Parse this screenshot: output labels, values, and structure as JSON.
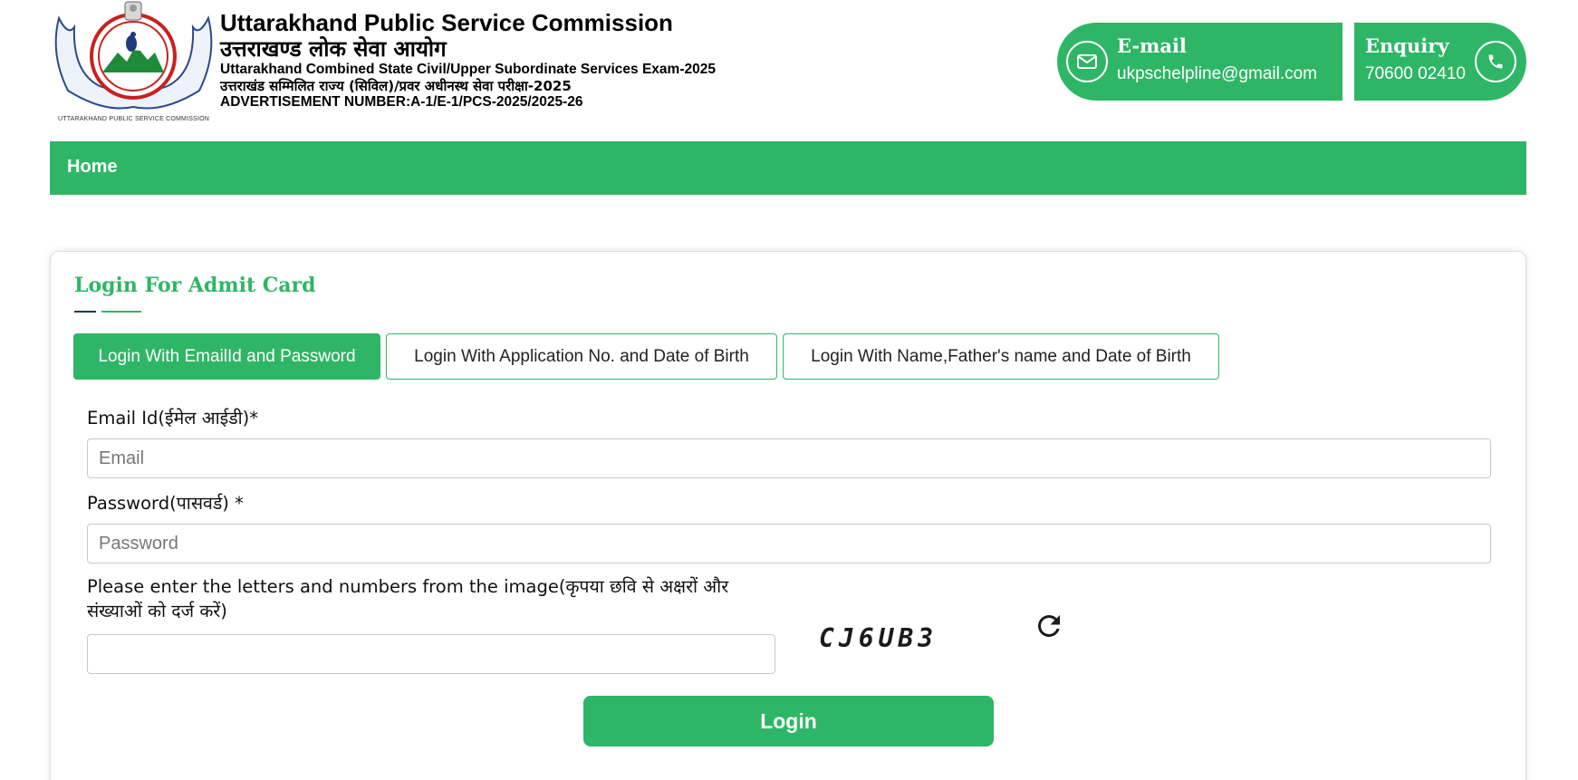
{
  "header": {
    "logo_caption": "UTTARAKHAND PUBLIC SERVICE COMMISSION",
    "logo_hindi": "उत्तराखण्ड लोकसेवा आयोग",
    "title_en": "Uttarakhand Public Service Commission",
    "title_hi": "उत्तराखण्ड लोक सेवा आयोग",
    "exam_en": "Uttarakhand Combined State Civil/Upper Subordinate Services Exam-2025",
    "exam_hi": "उत्तराखंड सम्मिलित राज्य (सिविल)/प्रवर अधीनस्थ सेवा परीक्षा-2025",
    "advertisement": "ADVERTISEMENT NUMBER:A-1/E-1/PCS-2025/2025-26"
  },
  "contact": {
    "email_label": "E-mail",
    "email_value": "ukpschelpline@gmail.com",
    "enquiry_label": "Enquiry",
    "enquiry_value": "70600 02410"
  },
  "nav": {
    "home": "Home"
  },
  "login": {
    "title": "Login For Admit Card",
    "tabs": [
      {
        "label": "Login With EmailId and Password",
        "active": true
      },
      {
        "label": "Login With Application No. and Date of Birth",
        "active": false
      },
      {
        "label": "Login With Name,Father's name and Date of Birth",
        "active": false
      }
    ],
    "email_label": "Email Id(ईमेल आईडी)*",
    "email_placeholder": "Email",
    "password_label": "Password(पासवर्ड) *",
    "password_placeholder": "Password",
    "captcha_label": "Please enter the letters and numbers from the image(कृपया छवि से अक्षरों और संख्याओं को दर्ज करें)",
    "captcha_value": "",
    "captcha_text": "CJ6UB3",
    "login_button": "Login"
  },
  "colors": {
    "brand_green": "#2eb666",
    "underline_navy": "#1f3a5c"
  },
  "icons": {
    "email": "envelope-icon",
    "enquiry": "phone-icon",
    "refresh": "refresh-icon"
  }
}
